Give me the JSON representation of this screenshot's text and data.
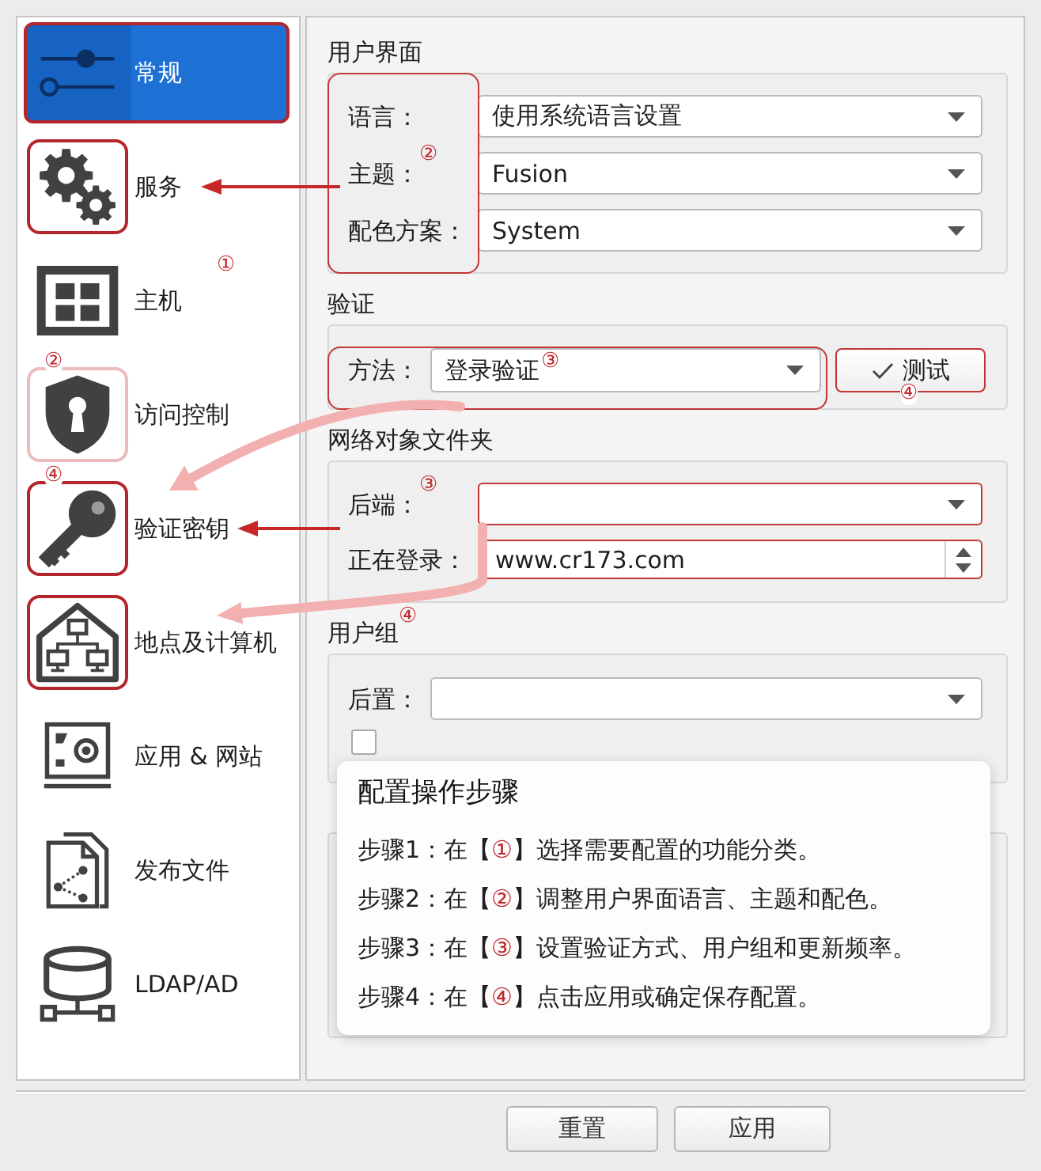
{
  "sidebar": {
    "items": [
      {
        "label": "常规",
        "selected": true,
        "kind": "framed"
      },
      {
        "label": "服务",
        "selected": false,
        "kind": "framed"
      },
      {
        "label": "主机",
        "selected": false,
        "kind": "plain",
        "label_marker": "①"
      },
      {
        "label": "访问控制",
        "selected": false,
        "kind": "faint",
        "icon_marker": "②"
      },
      {
        "label": "验证密钥",
        "selected": false,
        "kind": "framed",
        "icon_marker": "④"
      },
      {
        "label": "地点及计算机",
        "selected": false,
        "kind": "framed"
      },
      {
        "label": "应用 & 网站",
        "selected": false,
        "kind": "plain"
      },
      {
        "label": "发布文件",
        "selected": false,
        "kind": "plain"
      },
      {
        "label": "LDAP/AD",
        "selected": false,
        "kind": "plain"
      }
    ]
  },
  "sections": [
    {
      "title": "用户界面",
      "labels_outlined": true,
      "rows": [
        {
          "kind": "combo",
          "label": "语言：",
          "value": "使用系统语言设置",
          "outlined": false,
          "highlighted": false
        },
        {
          "kind": "combo",
          "label": "主题：",
          "label_marker": "②",
          "value": "Fusion",
          "outlined": false,
          "highlighted": false
        },
        {
          "kind": "combo",
          "label": "配色方案：",
          "value": "System",
          "outlined": false,
          "highlighted": false
        }
      ]
    },
    {
      "title": "验证",
      "labels_outlined": false,
      "rows": [
        {
          "kind": "combo",
          "label": "方法：",
          "value": "登录验证",
          "value_marker": "③",
          "outlined": true,
          "highlighted": false
        }
      ],
      "button": {
        "label": "测试",
        "highlighted": true,
        "marker": "④"
      }
    },
    {
      "title": "网络对象文件夹",
      "labels_outlined": false,
      "rows": [
        {
          "kind": "combo",
          "label": "后端：",
          "label_marker": "③",
          "outlined": false,
          "highlighted": true
        },
        {
          "kind": "spin",
          "label": "正在登录：",
          "value": "www.cr173.com",
          "outlined": false,
          "highlighted": true
        }
      ]
    },
    {
      "title": "用户组",
      "title_marker": "④",
      "labels_outlined": false,
      "rows": [
        {
          "kind": "combo",
          "label": "后置：",
          "outlined": false,
          "highlighted": false
        },
        {
          "kind": "checkbox",
          "checked": false
        }
      ]
    }
  ],
  "guide": {
    "title": "配置操作步骤",
    "steps": [
      {
        "before": "步骤1：在【",
        "marker": "①",
        "after": "】选择需要配置的功能分类。"
      },
      {
        "before": "步骤2：在【",
        "marker": "②",
        "after": "】调整用户界面语言、主题和配色。"
      },
      {
        "before": "步骤3：在【",
        "marker": "③",
        "after": "】设置验证方式、用户组和更新频率。"
      },
      {
        "before": "步骤4：在【",
        "marker": "④",
        "after": "】点击应用或确定保存配置。"
      }
    ]
  },
  "buttons": [
    "重置",
    "应用"
  ]
}
